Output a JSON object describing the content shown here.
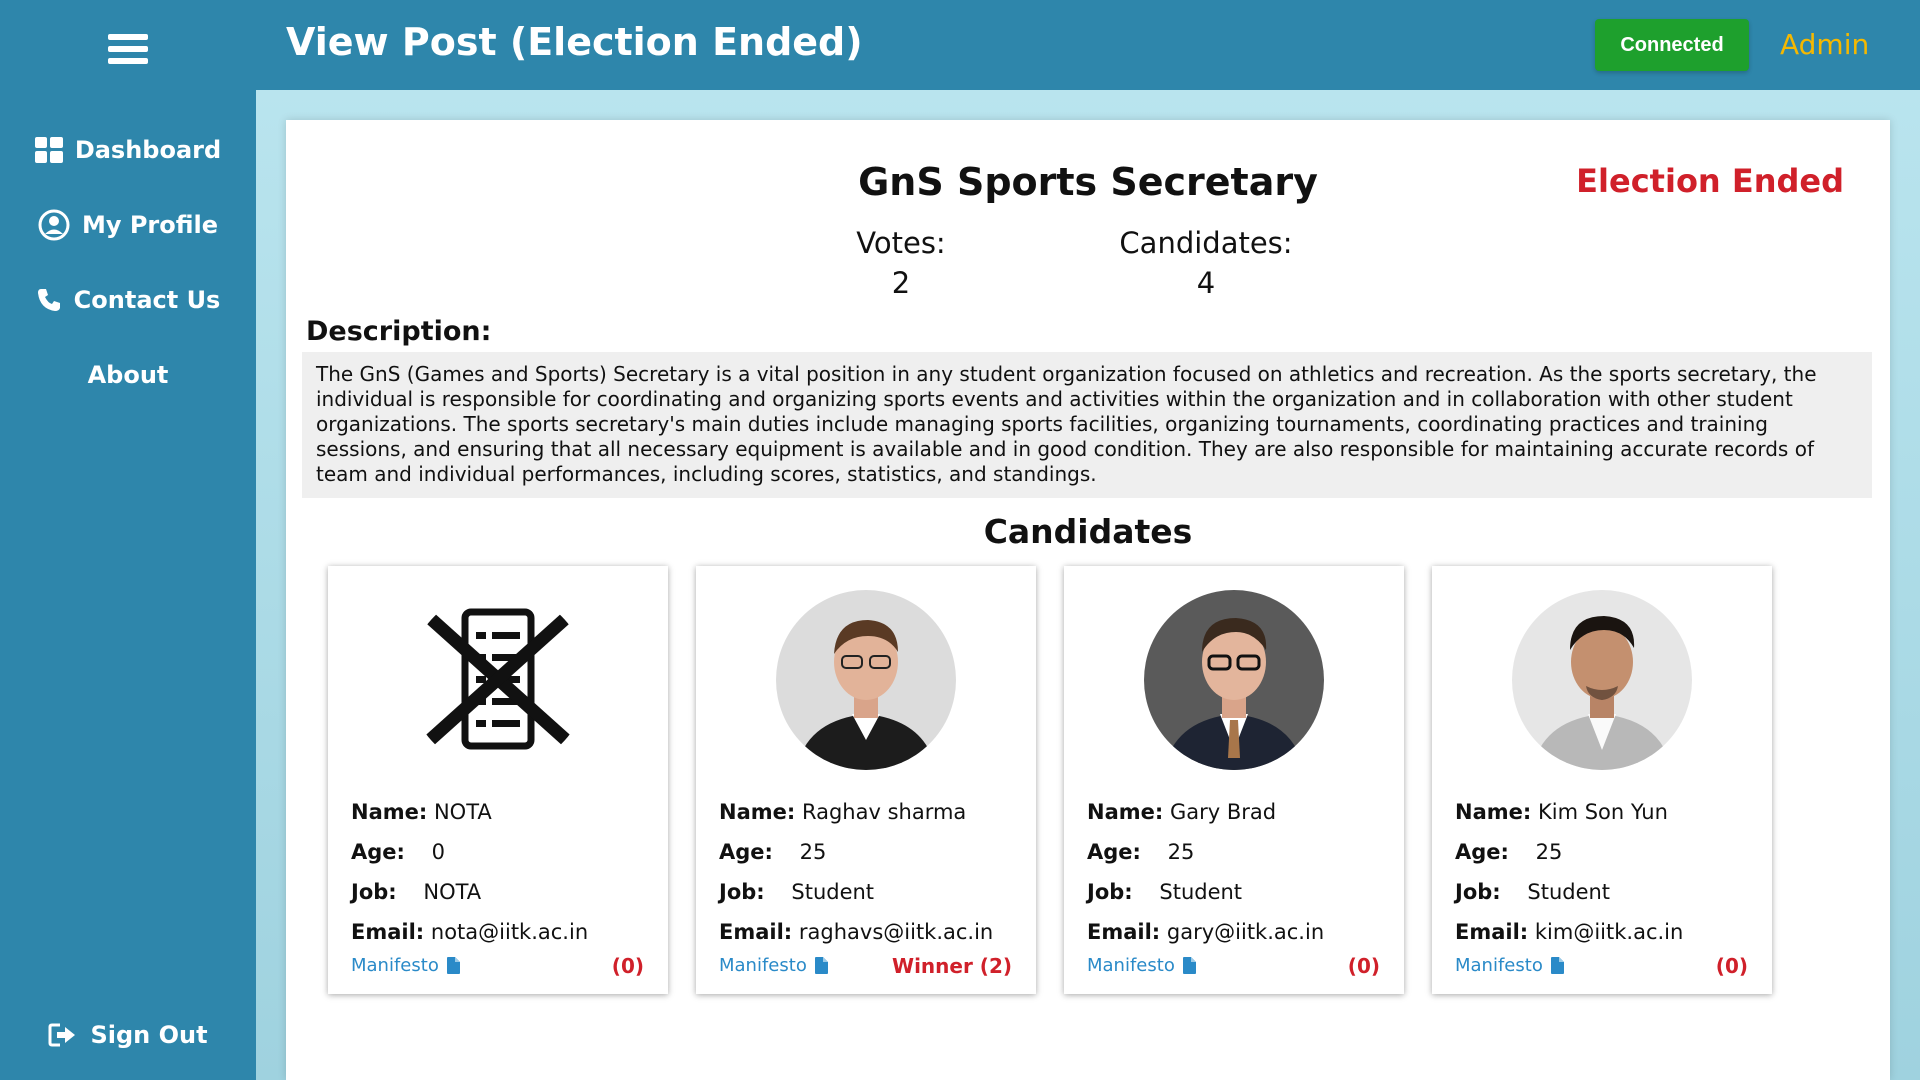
{
  "header": {
    "title": "View Post (Election Ended)",
    "connected_label": "Connected",
    "admin_label": "Admin"
  },
  "sidebar": {
    "items": [
      {
        "label": "Dashboard",
        "icon": "dashboard-icon"
      },
      {
        "label": "My Profile",
        "icon": "user-circle-icon"
      },
      {
        "label": "Contact Us",
        "icon": "phone-icon"
      },
      {
        "label": "About",
        "icon": ""
      }
    ],
    "signout_label": "Sign Out"
  },
  "post": {
    "title": "GnS Sports Secretary",
    "status": "Election Ended",
    "votes_label": "Votes:",
    "votes": "2",
    "candidates_label": "Candidates:",
    "candidates_count": "4",
    "description_label": "Description:",
    "description": "The GnS (Games and Sports) Secretary is a vital position in any student organization focused on athletics and recreation. As the sports secretary, the individual is responsible for coordinating and organizing sports events and activities within the organization and in collaboration with other student organizations. The sports secretary's main duties include managing sports facilities, organizing tournaments, coordinating practices and training sessions, and ensuring that all necessary equipment is available and in good condition. They are also responsible for maintaining accurate records of team and individual performances, including scores, statistics, and standings."
  },
  "candidates_heading": "Candidates",
  "labels": {
    "name": "Name:",
    "age": "Age:",
    "job": "Job:",
    "email": "Email:",
    "manifesto": "Manifesto"
  },
  "candidates": [
    {
      "name": "NOTA",
      "age": "0",
      "job": "NOTA",
      "email": "nota@iitk.ac.in",
      "result": "(0)"
    },
    {
      "name": "Raghav sharma",
      "age": "25",
      "job": "Student",
      "email": "raghavs@iitk.ac.in",
      "result": "Winner (2)"
    },
    {
      "name": "Gary Brad",
      "age": "25",
      "job": "Student",
      "email": "gary@iitk.ac.in",
      "result": "(0)"
    },
    {
      "name": "Kim Son Yun",
      "age": "25",
      "job": "Student",
      "email": "kim@iitk.ac.in",
      "result": "(0)"
    }
  ],
  "colors": {
    "primary": "#2e86ab",
    "connected": "#1ea02d",
    "admin": "#f5b800",
    "ended": "#d0202a",
    "link": "#2a8ac8"
  }
}
